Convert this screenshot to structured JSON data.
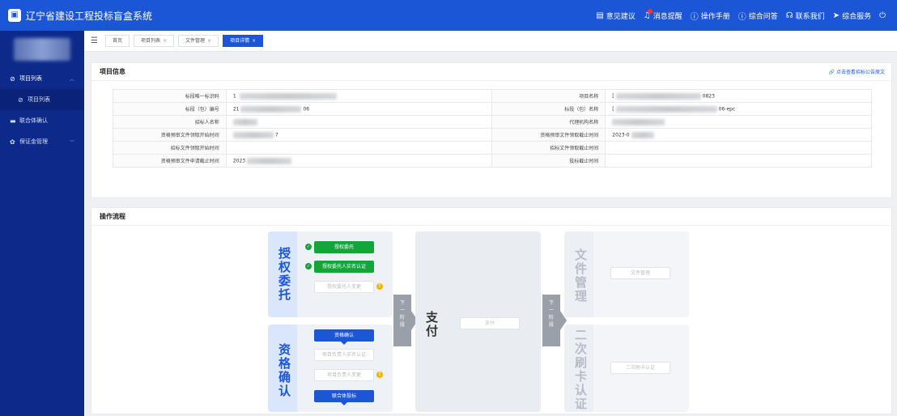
{
  "header": {
    "title": "辽宁省建设工程投标盲盒系统",
    "actions": [
      {
        "label": "意见建议",
        "icon": "feedback-icon"
      },
      {
        "label": "消息提醒",
        "icon": "bell-icon"
      },
      {
        "label": "操作手册",
        "icon": "help-circle-icon"
      },
      {
        "label": "综合问答",
        "icon": "help-circle-icon"
      },
      {
        "label": "联系我们",
        "icon": "headset-icon"
      },
      {
        "label": "综合服务",
        "icon": "send-icon"
      }
    ]
  },
  "sidebar": {
    "items": [
      {
        "label": "项目列表",
        "icon": "folder-icon"
      },
      {
        "label": "项目列表",
        "icon": "list-icon"
      },
      {
        "label": "联合体确认",
        "icon": "group-icon"
      },
      {
        "label": "保证金管理",
        "icon": "gear-icon"
      }
    ]
  },
  "tabs": [
    {
      "label": "首页"
    },
    {
      "label": "项目列表"
    },
    {
      "label": "文件管理"
    },
    {
      "label": "项目详情"
    }
  ],
  "project_info": {
    "title": "项目信息",
    "link": "点击查看招标公告原文",
    "rows": [
      {
        "l1": "标段唯一标识码",
        "v1": "1",
        "l2": "项目名称",
        "v2": "[",
        "v2_tail": "0823"
      },
      {
        "l1": "标段（包）编号",
        "v1": "21",
        "v1_tail": "06",
        "l2": "标段（包）名称",
        "v2": "[",
        "v2_tail": "06-epc"
      },
      {
        "l1": "招标人名称",
        "v1": "",
        "l2": "代理机构名称",
        "v2": ""
      },
      {
        "l1": "资格预审文件领取开始时间",
        "v1": "",
        "v1_tail": "7",
        "l2": "资格预审文件领取截止时间",
        "v2": "2023-0"
      },
      {
        "l1": "招标文件领取开始时间",
        "v1": "",
        "l2": "招标文件领取截止时间",
        "v2": ""
      },
      {
        "l1": "资格预审文件申请截止时间",
        "v1": "2023",
        "l2": "投标截止时间",
        "v2": ""
      }
    ]
  },
  "process": {
    "title": "操作流程",
    "stage1_label": "授权委托",
    "stage1_buttons": [
      "授权委托",
      "授权委托人实名认证",
      "授权委托人变更"
    ],
    "stage2_label": "资格确认",
    "stage2_buttons": [
      "资格确认",
      "项目负责人实名认证",
      "项目负责人变更",
      "联合体投标"
    ],
    "next_stage_1": "下一阶段",
    "pay_label": "支付",
    "pay_button": "支付",
    "next_stage_2": "下一阶段",
    "file_label": "文件管理",
    "file_button": "文件管理",
    "card_label": "二次刷卡认证",
    "card_button": "二次刷卡认证"
  }
}
